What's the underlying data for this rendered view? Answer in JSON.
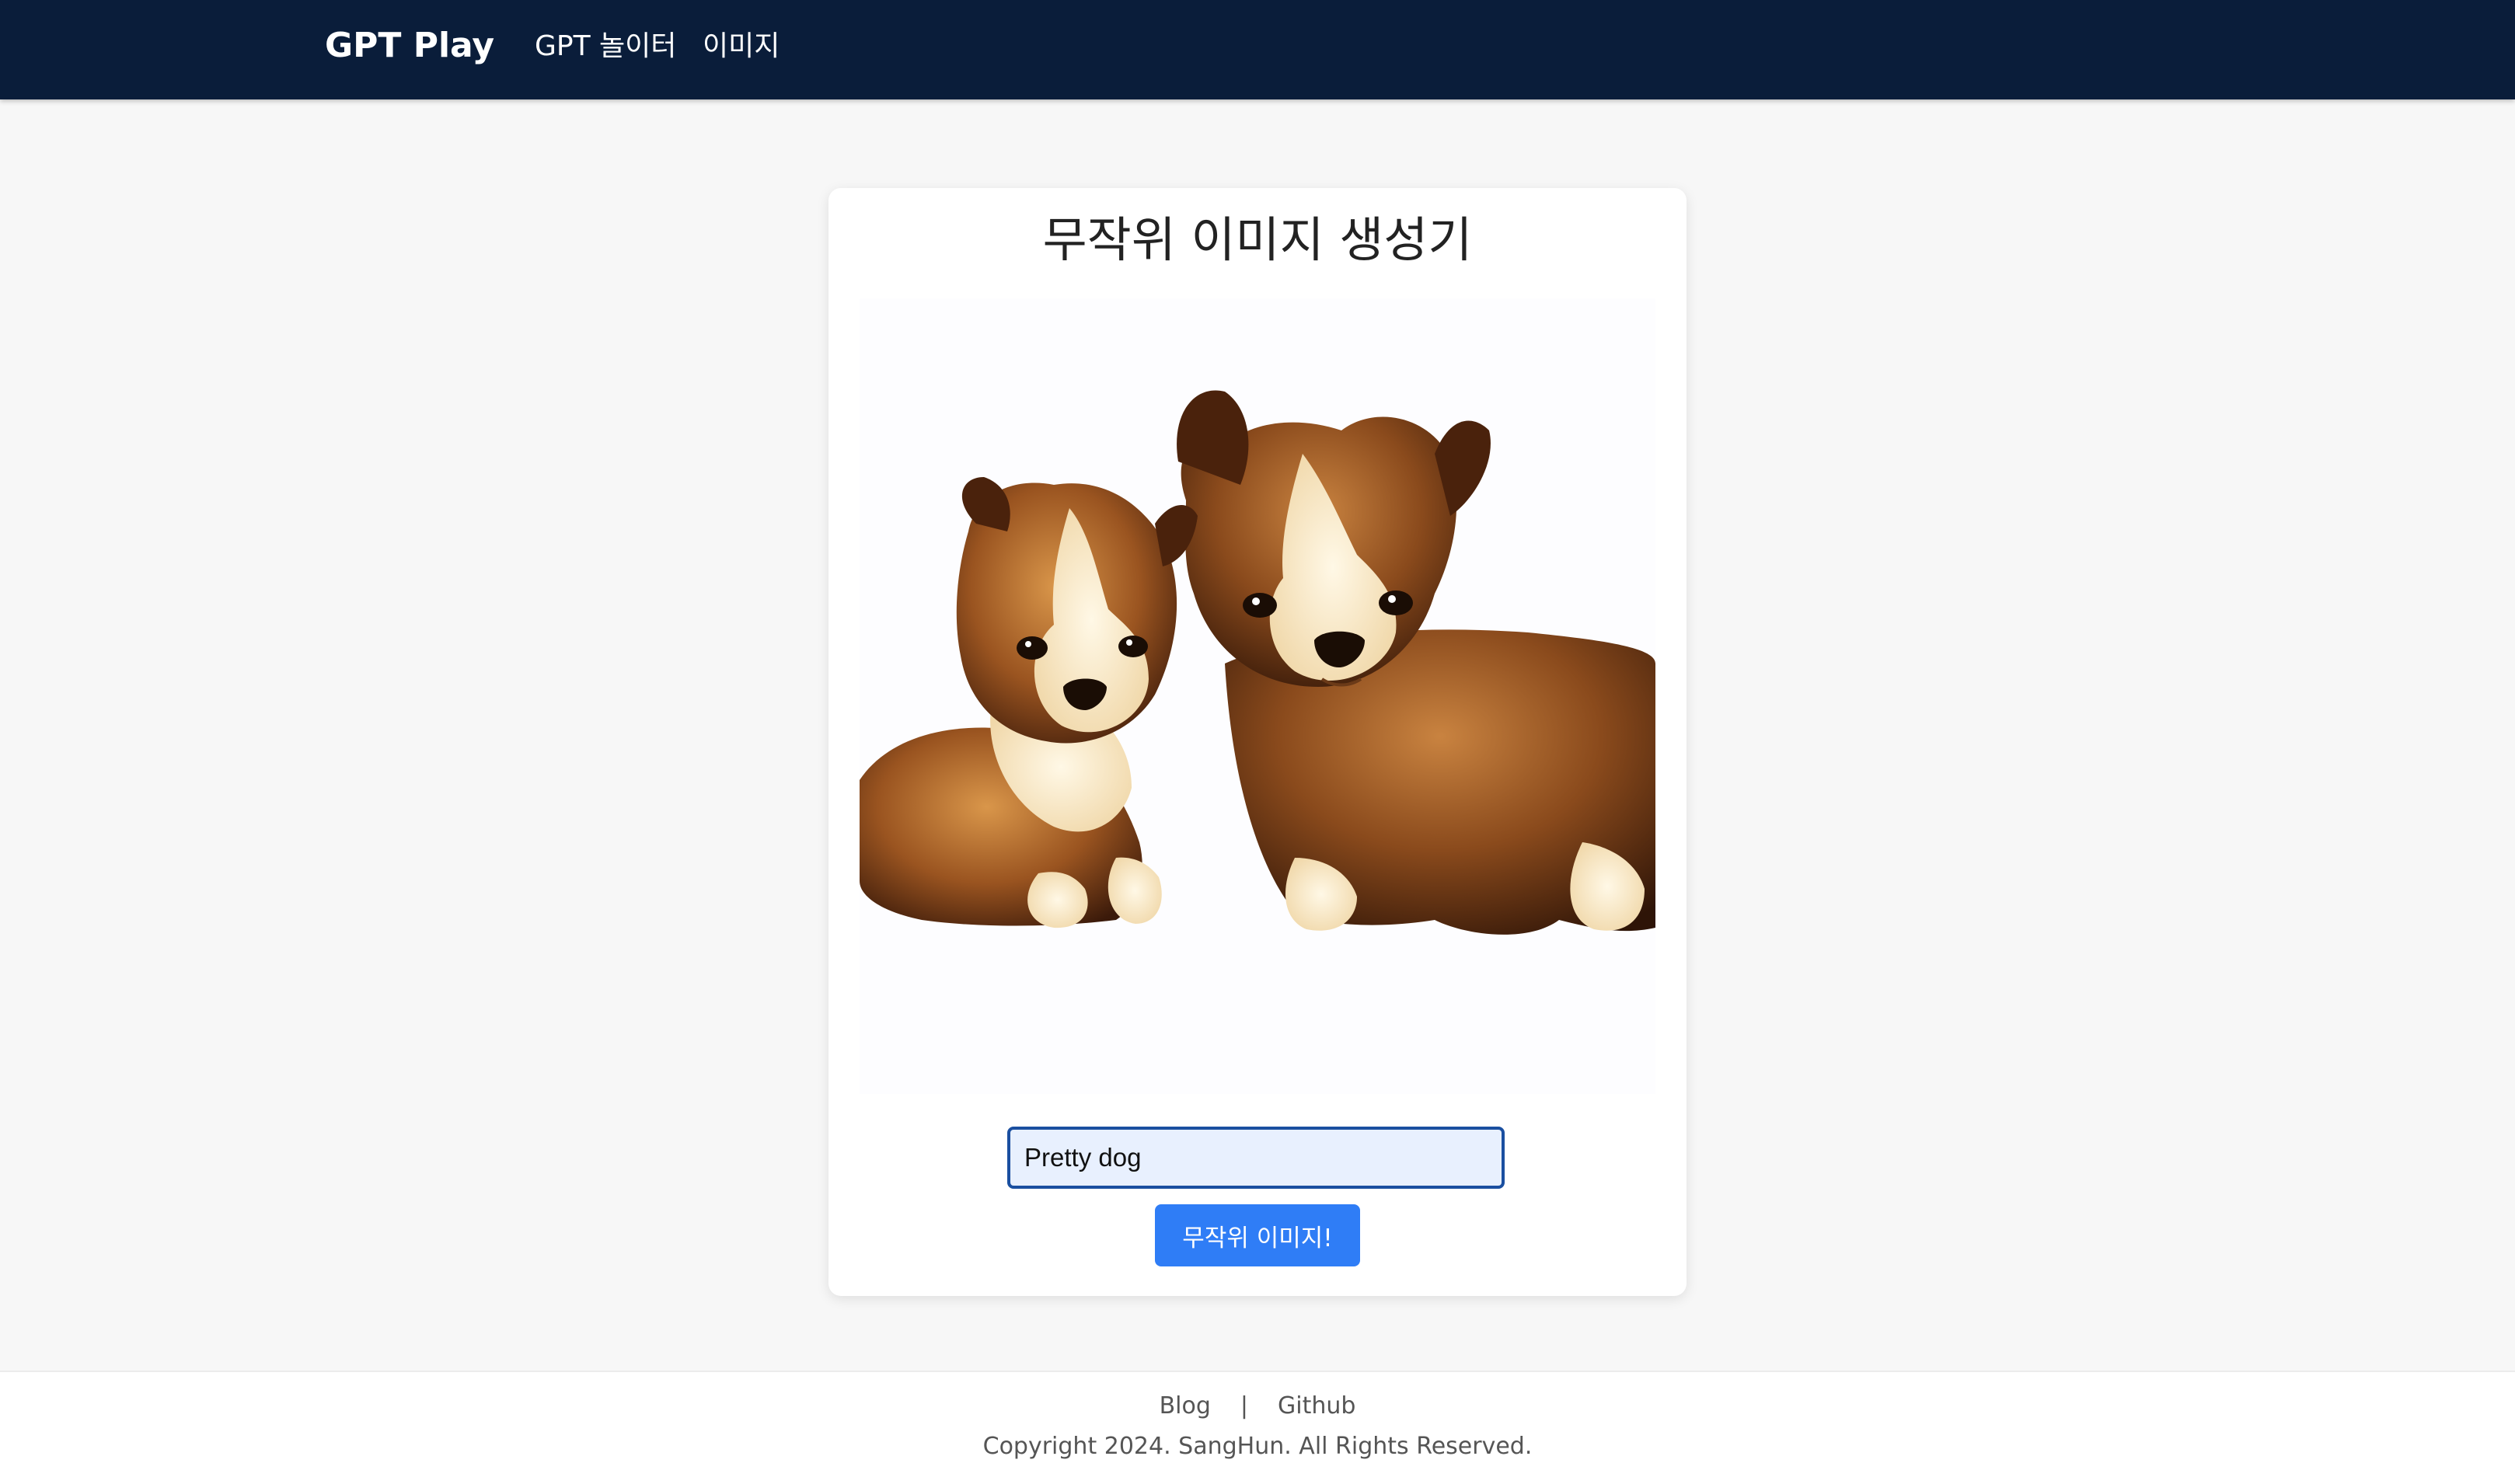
{
  "navbar": {
    "brand": "GPT Play",
    "links": [
      {
        "label": "GPT 놀이터"
      },
      {
        "label": "이미지"
      }
    ],
    "background": "#0a1d3a"
  },
  "main": {
    "title": "무작위 이미지 생성기",
    "image_alt": "generated-puppies-image",
    "prompt": {
      "value": "Pretty dog"
    },
    "generate_button": "무작위 이미지!",
    "accent_color": "#2f7df6"
  },
  "footer": {
    "links": [
      {
        "label": "Blog"
      },
      {
        "label": "Github"
      }
    ],
    "separator": "|",
    "copyright": "Copyright 2024. SangHun. All Rights Reserved."
  }
}
